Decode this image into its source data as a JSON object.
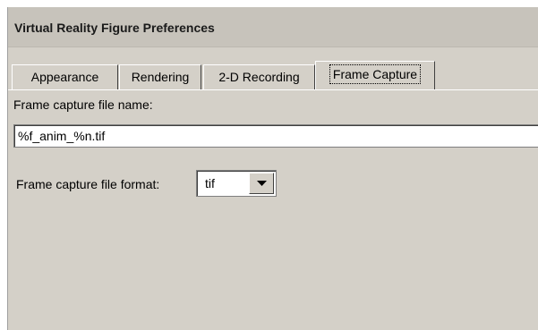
{
  "dialog": {
    "title": "Virtual Reality Figure Preferences"
  },
  "tabs": [
    {
      "label": "Appearance"
    },
    {
      "label": "Rendering"
    },
    {
      "label": "2-D Recording"
    },
    {
      "label": "Frame Capture",
      "selected": true
    }
  ],
  "frame_capture": {
    "file_name_label": "Frame capture file name:",
    "file_name_value": "%f_anim_%n.tif",
    "file_format_label": "Frame capture file format:",
    "file_format_value": "tif",
    "dropdown_icon": "chevron-down-icon"
  }
}
